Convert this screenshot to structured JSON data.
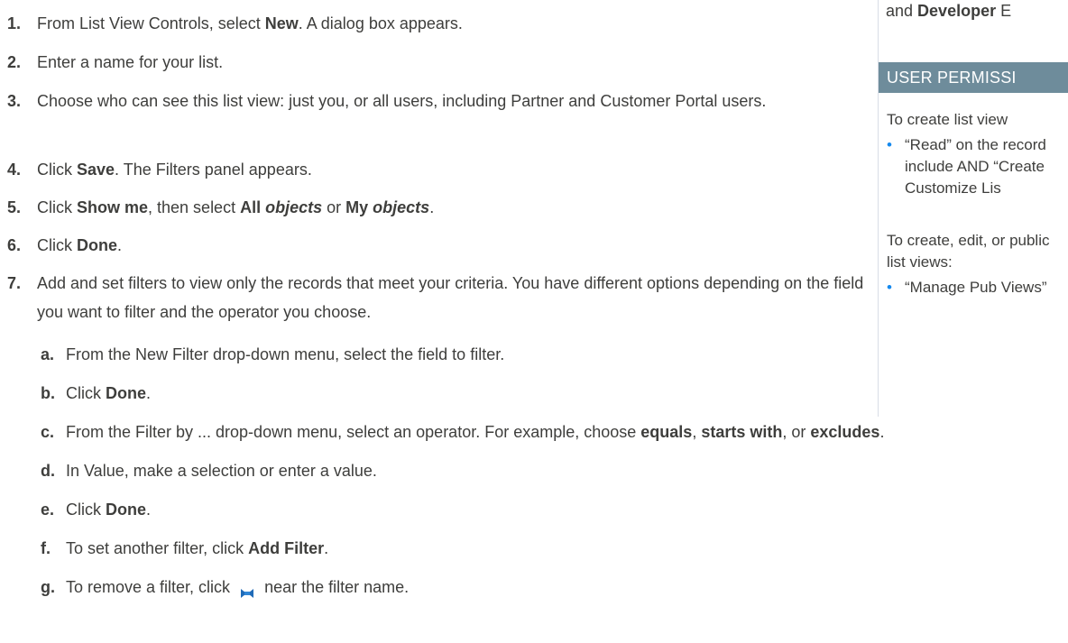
{
  "steps": [
    {
      "num": "1.",
      "pre": "From List View Controls, select ",
      "b1": "New",
      "post": ". A dialog box appears."
    },
    {
      "num": "2.",
      "text": "Enter a name for your list."
    },
    {
      "num": "3.",
      "text": "Choose who can see this list view: just you, or all users, including Partner and Customer Portal users."
    },
    {
      "num": "4.",
      "pre": "Click ",
      "b1": "Save",
      "post": ". The Filters panel appears."
    },
    {
      "num": "5.",
      "pre": "Click ",
      "b1": "Show me",
      "mid1": ", then select ",
      "b2": "All ",
      "b2i": "objects",
      "mid2": " or ",
      "b3": "My ",
      "b3i": "objects",
      "post": "."
    },
    {
      "num": "6.",
      "pre": "Click ",
      "b1": "Done",
      "post": "."
    },
    {
      "num": "7.",
      "text": "Add and set filters to view only the records that meet your criteria. You have different options depending on the field you want to filter and the operator you choose."
    }
  ],
  "substeps": [
    {
      "num": "a.",
      "text": "From the New Filter drop-down menu, select the field to filter."
    },
    {
      "num": "b.",
      "pre": "Click ",
      "b1": "Done",
      "post": "."
    },
    {
      "num": "c.",
      "pre": "From the Filter by ... drop-down menu, select an operator. For example, choose ",
      "b1": "equals",
      "mid1": ", ",
      "b2": "starts with",
      "mid2": ", or ",
      "b3": "excludes",
      "post": "."
    },
    {
      "num": "d.",
      "text": "In Value, make a selection or enter a value."
    },
    {
      "num": "e.",
      "pre": "Click ",
      "b1": "Done",
      "post": "."
    },
    {
      "num": "f.",
      "pre": "To set another filter, click ",
      "b1": "Add Filter",
      "post": "."
    },
    {
      "num": "g.",
      "pre": "To remove a filter, click ",
      "post": " near the filter name.",
      "icon": "remove-filter-icon"
    }
  ],
  "sidebar": {
    "editions_pre": "and ",
    "editions_bold": "Developer",
    "editions_post": " E",
    "permissions_header": "USER PERMISSI",
    "perm1_intro": "To create list view",
    "perm1_item": "“Read” on the record include AND “Create Customize Lis",
    "perm2_intro": "To create, edit, or public list views:",
    "perm2_item": "“Manage Pub Views”",
    "accent_color": "#6e8c9b",
    "bullet_color": "#1589ee"
  }
}
